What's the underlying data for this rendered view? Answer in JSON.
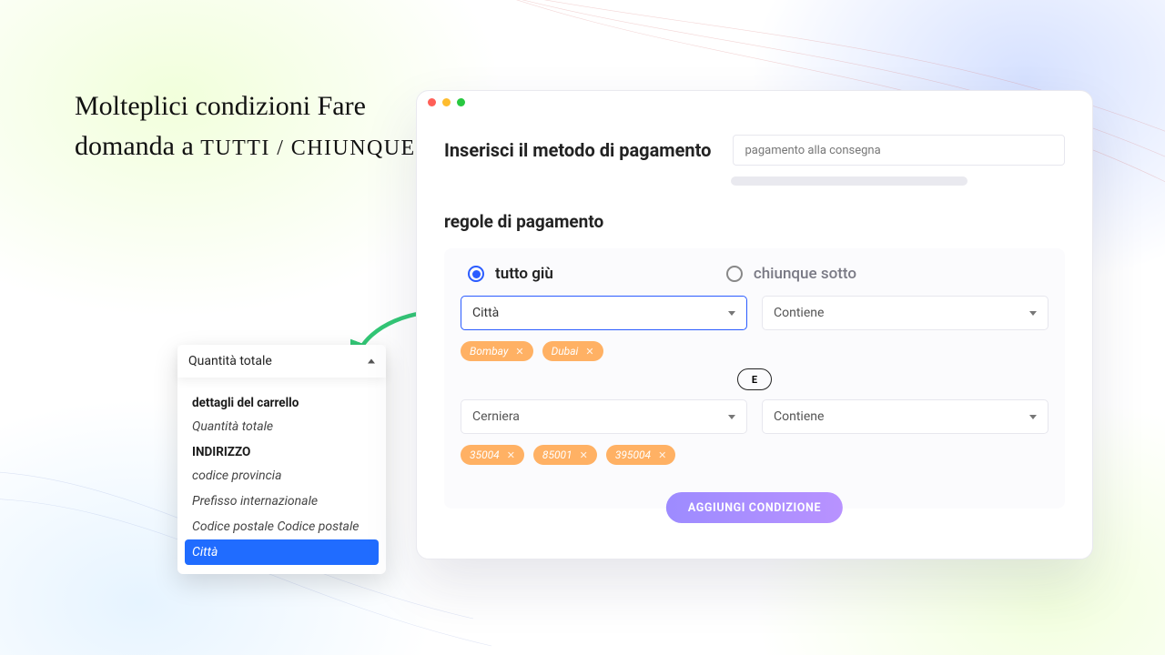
{
  "headline": {
    "line1": "Molteplici condizioni Fare",
    "line2_pre": "domanda a ",
    "line2_small": "TUTTI / CHIUNQUE"
  },
  "popover": {
    "current": "Quantità totale",
    "groups": [
      {
        "label": "dettagli del carrello",
        "items": [
          "Quantità totale"
        ]
      },
      {
        "label": "INDIRIZZO",
        "items": [
          "codice provincia",
          "Prefisso internazionale",
          "Codice postale Codice postale",
          "Città"
        ]
      }
    ],
    "selected": "Città"
  },
  "card": {
    "section1_title": "Inserisci il metodo di pagamento",
    "payment_method_value": "pagamento alla consegna",
    "section2_title": "regole di pagamento",
    "radio_all": "tutto giù",
    "radio_any": "chiunque sotto",
    "radio_checked": "all",
    "rule1": {
      "field": "Città",
      "op": "Contiene",
      "chips": [
        "Bombay",
        "Dubai"
      ]
    },
    "and_label": "E",
    "rule2": {
      "field": "Cerniera",
      "op": "Contiene",
      "chips": [
        "35004",
        "85001",
        "395004"
      ]
    },
    "add_button": "AGGIUNGI CONDIZIONE"
  }
}
